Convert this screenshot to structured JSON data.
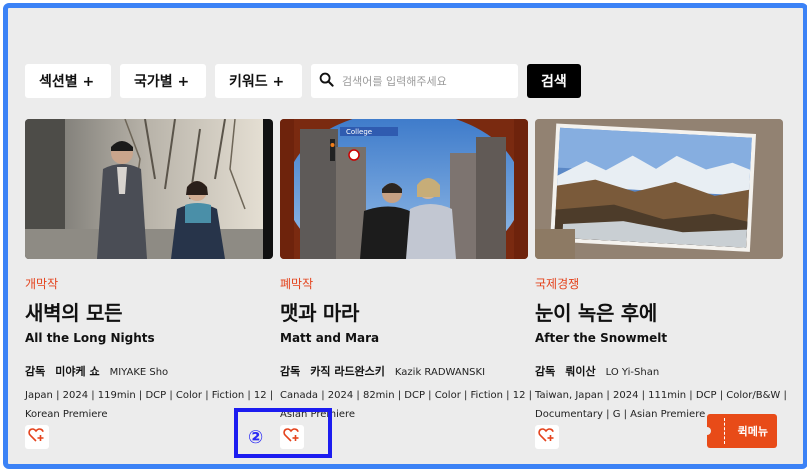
{
  "filters": {
    "section_label": "섹션별 +",
    "country_label": "국가별 +",
    "keyword_label": "키워드 +",
    "search_placeholder": "검색어를 입력해주세요",
    "search_button": "검색"
  },
  "films": [
    {
      "category": "개막작",
      "title_ko": "새벽의 모든",
      "title_en": "All the Long Nights",
      "director_label": "감독",
      "director_ko": "미야케 쇼",
      "director_en": "MIYAKE Sho",
      "meta": "Japan | 2024 | 119min | DCP | Color | Fiction | 12 | Korean Premiere"
    },
    {
      "category": "폐막작",
      "title_ko": "맷과 마라",
      "title_en": "Matt and Mara",
      "director_label": "감독",
      "director_ko": "카직 라드완스키",
      "director_en": "Kazik RADWANSKI",
      "meta": "Canada | 2024 | 82min | DCP | Color | Fiction | 12 | Asian Premiere",
      "sign_text": "College"
    },
    {
      "category": "국제경쟁",
      "title_ko": "눈이 녹은 후에",
      "title_en": "After the Snowmelt",
      "director_label": "감독",
      "director_ko": "뤄이산",
      "director_en": "LO Yi-Shan",
      "meta": "Taiwan, Japan | 2024 | 111min | DCP | Color/B&W | Documentary | G | Asian Premiere"
    }
  ],
  "annotation": {
    "marker": "②"
  },
  "quick_menu": {
    "label": "퀵메뉴"
  },
  "colors": {
    "accent": "#e4431d",
    "highlight": "#1c1cf0",
    "frame": "#3b82f6"
  }
}
